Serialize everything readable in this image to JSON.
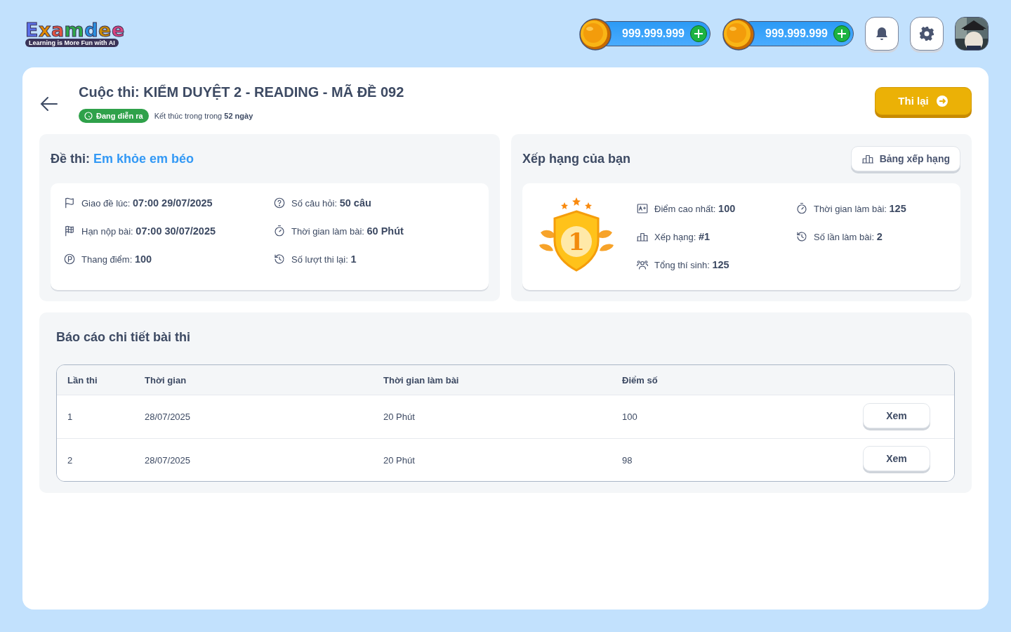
{
  "header": {
    "logo": {
      "name": "Examdee",
      "tagline": "Learning is More Fun with AI"
    },
    "balances": [
      {
        "amount": "999.999.999"
      },
      {
        "amount": "999.999.999"
      }
    ]
  },
  "contest": {
    "title": "Cuộc thi: KIỂM DUYỆT 2 - READING - MÃ ĐỀ 092",
    "status": "Đang diễn ra",
    "deadline": "Kết thúc trong trong **52 ngày**",
    "retry_button": "Thi lại"
  },
  "exam": {
    "label": "Đề thi:",
    "name": "Em khỏe em béo",
    "items": [
      {
        "label": "Giao đề lúc:",
        "value": "07:00 29/07/2025"
      },
      {
        "label": "Số câu hỏi:",
        "value": "50 câu"
      },
      {
        "label": "Hạn nộp bài:",
        "value": "07:00 30/07/2025"
      },
      {
        "label": "Thời gian làm bài:",
        "value": "60 Phút"
      },
      {
        "label": "Thang điểm:",
        "value": "100"
      },
      {
        "label": "Số lượt thi lại:",
        "value": "1"
      }
    ]
  },
  "ranking": {
    "title": "Xếp hạng của bạn",
    "leaderboard_button": "Bảng xếp hạng",
    "medal": "1",
    "items": [
      {
        "label": "Điểm cao nhất:",
        "value": "100"
      },
      {
        "label": "Thời gian làm bài:",
        "value": "125"
      },
      {
        "label": "Xếp hạng:",
        "value": "#1"
      },
      {
        "label": "Số lần làm bài:",
        "value": "2"
      },
      {
        "label": "Tổng thí sinh:",
        "value": "125"
      }
    ]
  },
  "report": {
    "title": "Báo cáo chi tiết bài thi",
    "columns": [
      "Lần thi",
      "Thời gian",
      "Thời gian làm bài",
      "Điểm số"
    ],
    "rows": [
      {
        "cells": [
          "1",
          "28/07/2025",
          "20 Phút",
          "100"
        ],
        "action": "Xem"
      },
      {
        "cells": [
          "2",
          "28/07/2025",
          "20 Phút",
          "98"
        ],
        "action": "Xem"
      }
    ]
  }
}
